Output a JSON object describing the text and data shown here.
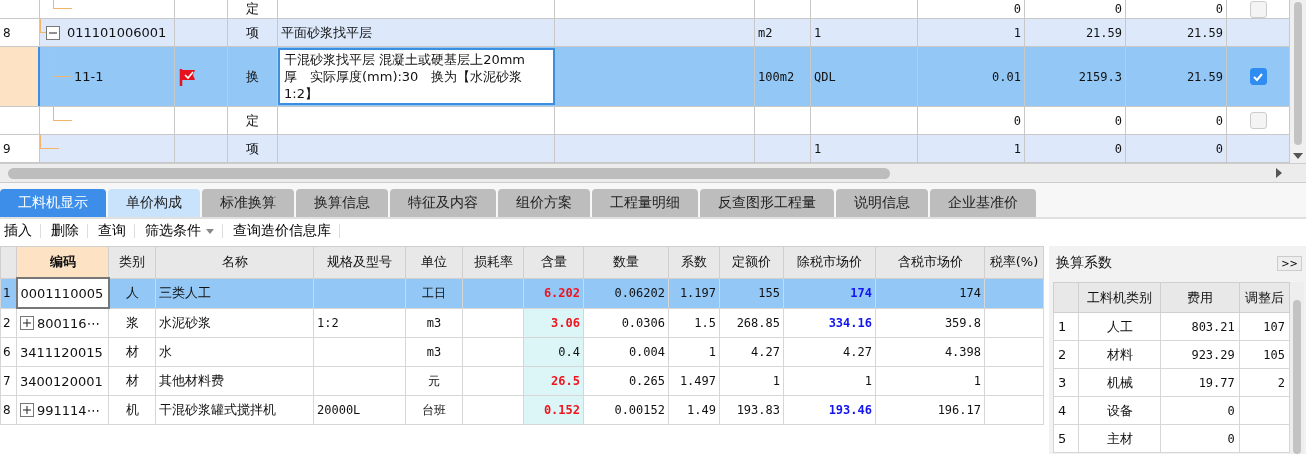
{
  "top_grid": {
    "rows": [
      {
        "children": [
          {
            "type": "定",
            "column_8": "0",
            "column_9": "0",
            "column_10": "0",
            "checked": false,
            "selected": false
          }
        ]
      },
      {
        "row_no": "8",
        "code": "011101006001",
        "expanded": true,
        "type": "项",
        "name": "平面砂浆找平层",
        "unit": "m2",
        "column_7": "1",
        "column_8": "1",
        "column_9": "21.59",
        "column_10": "21.59",
        "selected": false,
        "children": [
          {
            "code": "11-1",
            "flagged": true,
            "type": "换",
            "name": "干混砂浆找平层 混凝土或硬基层上20mm厚　实际厚度(mm):30　换为【水泥砂浆 1:2】",
            "unit": "100m2",
            "column_7": "QDL",
            "column_8": "0.01",
            "column_9": "2159.3",
            "column_10": "21.59",
            "checked": true,
            "selected": true
          },
          {
            "type": "定",
            "column_8": "0",
            "column_9": "0",
            "column_10": "0",
            "checked": false,
            "selected": false
          }
        ]
      },
      {
        "row_no": "9",
        "type": "项",
        "column_7": "1",
        "column_8": "1",
        "column_9": "0",
        "column_10": "0",
        "selected": false
      }
    ]
  },
  "tabs": [
    {
      "label": "工料机显示",
      "selected": true,
      "highlighted": false
    },
    {
      "label": "单价构成",
      "selected": false,
      "highlighted": true
    },
    {
      "label": "标准换算",
      "selected": false,
      "highlighted": false
    },
    {
      "label": "换算信息",
      "selected": false,
      "highlighted": false
    },
    {
      "label": "特征及内容",
      "selected": false,
      "highlighted": false
    },
    {
      "label": "组价方案",
      "selected": false,
      "highlighted": false
    },
    {
      "label": "工程量明细",
      "selected": false,
      "highlighted": false
    },
    {
      "label": "反查图形工程量",
      "selected": false,
      "highlighted": false
    },
    {
      "label": "说明信息",
      "selected": false,
      "highlighted": false
    },
    {
      "label": "企业基准价",
      "selected": false,
      "highlighted": false
    }
  ],
  "toolbar": [
    {
      "label": "插入",
      "dropdown": false
    },
    {
      "label": "删除",
      "dropdown": false
    },
    {
      "label": "查询",
      "dropdown": false
    },
    {
      "label": "筛选条件",
      "dropdown": true
    },
    {
      "label": "查询造价信息库",
      "dropdown": false
    }
  ],
  "resource_grid": {
    "columns": [
      "编码",
      "类别",
      "名称",
      "规格及型号",
      "单位",
      "损耗率",
      "含量",
      "数量",
      "系数",
      "定额价",
      "除税市场价",
      "含税市场价",
      "税率(%)"
    ],
    "rows": [
      {
        "row_no": "1",
        "code": "0001110005",
        "expanded": null,
        "category": "人",
        "name": "三类人工",
        "spec": "",
        "unit": "工日",
        "content": "6.202",
        "content_changed": true,
        "quantity": "0.06202",
        "factor": "1.197",
        "quota_price": "155",
        "market_price": "174",
        "price_changed": true,
        "market_price_tax": "174",
        "selected": true
      },
      {
        "row_no": "2",
        "code": "800116⋯",
        "expanded": false,
        "category": "浆",
        "name": "水泥砂浆",
        "spec": "1:2",
        "unit": "m3",
        "content": "3.06",
        "content_changed": true,
        "quantity": "0.0306",
        "factor": "1.5",
        "quota_price": "268.85",
        "market_price": "334.16",
        "price_changed": true,
        "market_price_tax": "359.8",
        "selected": false
      },
      {
        "row_no": "6",
        "code": "3411120015",
        "expanded": null,
        "category": "材",
        "name": "水",
        "spec": "",
        "unit": "m3",
        "content": "0.4",
        "content_changed": false,
        "quantity": "0.004",
        "factor": "1",
        "quota_price": "4.27",
        "market_price": "4.27",
        "price_changed": false,
        "market_price_tax": "4.398",
        "selected": false
      },
      {
        "row_no": "7",
        "code": "3400120001",
        "expanded": null,
        "category": "材",
        "name": "其他材料费",
        "spec": "",
        "unit": "元",
        "content": "26.5",
        "content_changed": true,
        "quantity": "0.265",
        "factor": "1.497",
        "quota_price": "1",
        "market_price": "1",
        "price_changed": false,
        "market_price_tax": "1",
        "selected": false
      },
      {
        "row_no": "8",
        "code": "991114⋯",
        "expanded": false,
        "category": "机",
        "name": "干混砂浆罐式搅拌机",
        "spec": "20000L",
        "unit": "台班",
        "content": "0.152",
        "content_changed": true,
        "quantity": "0.00152",
        "factor": "1.49",
        "quota_price": "193.83",
        "market_price": "193.46",
        "price_changed": true,
        "market_price_tax": "196.17",
        "selected": false
      }
    ]
  },
  "factor_panel": {
    "title": "换算系数",
    "collapse_button": ">>",
    "columns": [
      "工料机类别",
      "费用",
      "调整后"
    ],
    "rows": [
      {
        "row_no": "1",
        "category": "人工",
        "cost": "803.21",
        "adjusted": "107"
      },
      {
        "row_no": "2",
        "category": "材料",
        "cost": "923.29",
        "adjusted": "105"
      },
      {
        "row_no": "3",
        "category": "机械",
        "cost": "19.77",
        "adjusted": "2"
      },
      {
        "row_no": "4",
        "category": "设备",
        "cost": "0",
        "adjusted": ""
      },
      {
        "row_no": "5",
        "category": "主材",
        "cost": "0",
        "adjusted": ""
      }
    ]
  }
}
